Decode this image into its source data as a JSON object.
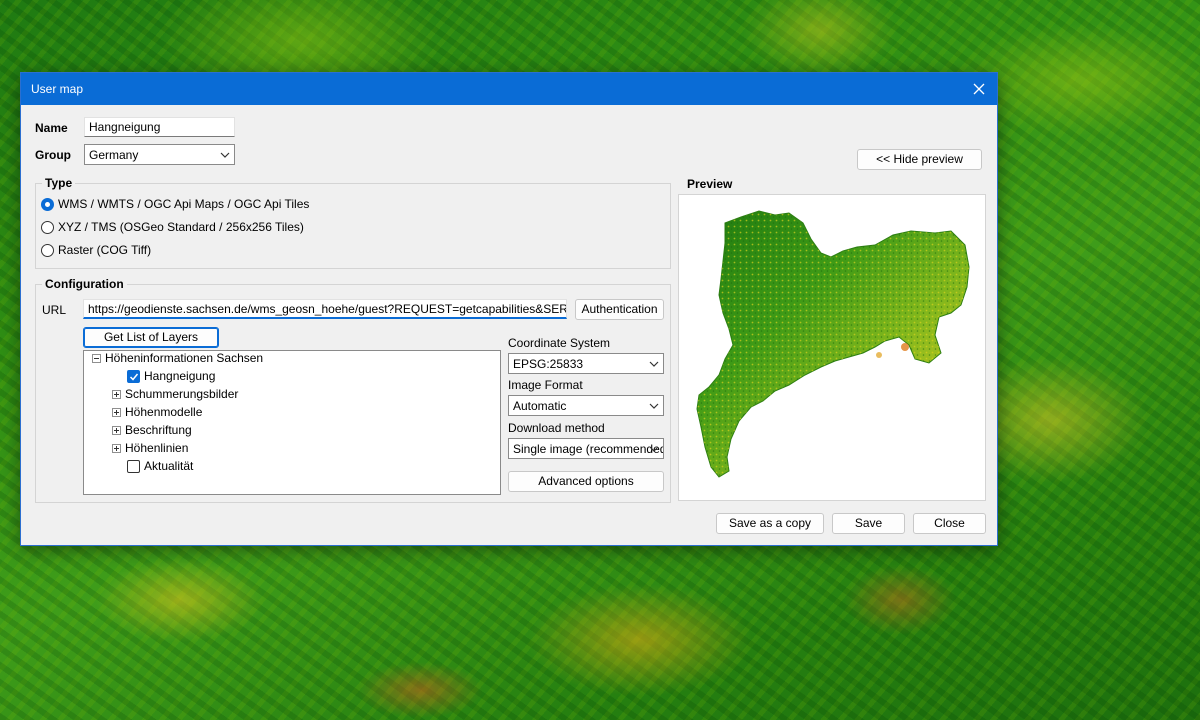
{
  "dialog": {
    "title": "User map"
  },
  "form": {
    "name_label": "Name",
    "name_value": "Hangneigung",
    "group_label": "Group",
    "group_value": "Germany"
  },
  "buttons": {
    "hide_preview": "<< Hide preview",
    "authentication": "Authentication",
    "get_layers": "Get List of Layers",
    "advanced": "Advanced options",
    "save_copy": "Save as a copy",
    "save": "Save",
    "close": "Close"
  },
  "type": {
    "legend": "Type",
    "options": [
      {
        "label": "WMS / WMTS / OGC Api Maps / OGC Api Tiles",
        "checked": true
      },
      {
        "label": "XYZ / TMS (OSGeo Standard / 256x256 Tiles)",
        "checked": false
      },
      {
        "label": "Raster (COG Tiff)",
        "checked": false
      }
    ]
  },
  "config": {
    "legend": "Configuration",
    "url_label": "URL",
    "url_value": "https://geodienste.sachsen.de/wms_geosn_hoehe/guest?REQUEST=getcapabilities&SERVICE=WMS",
    "coord_label": "Coordinate System",
    "coord_value": "EPSG:25833",
    "format_label": "Image Format",
    "format_value": "Automatic",
    "download_label": "Download method",
    "download_value": "Single image (recommended)"
  },
  "layers": {
    "root": "Höheninformationen Sachsen",
    "items": [
      {
        "label": "Hangneigung",
        "kind": "checkbox",
        "checked": true
      },
      {
        "label": "Schummerungsbilder",
        "kind": "expander"
      },
      {
        "label": "Höhenmodelle",
        "kind": "expander"
      },
      {
        "label": "Beschriftung",
        "kind": "expander"
      },
      {
        "label": "Höhenlinien",
        "kind": "expander"
      },
      {
        "label": "Aktualität",
        "kind": "checkbox",
        "checked": false
      }
    ]
  },
  "preview": {
    "legend": "Preview"
  },
  "icons": {
    "close": "close-icon",
    "dropdown": "chevron-down-icon",
    "check": "check-icon",
    "expand": "plus-expander-icon",
    "collapse": "minus-expander-icon"
  },
  "colors": {
    "accent": "#0a6cd6",
    "dialog_bg": "#f0f0f0",
    "map_green": "#2f8f14",
    "map_yellow": "#d8c81e"
  }
}
